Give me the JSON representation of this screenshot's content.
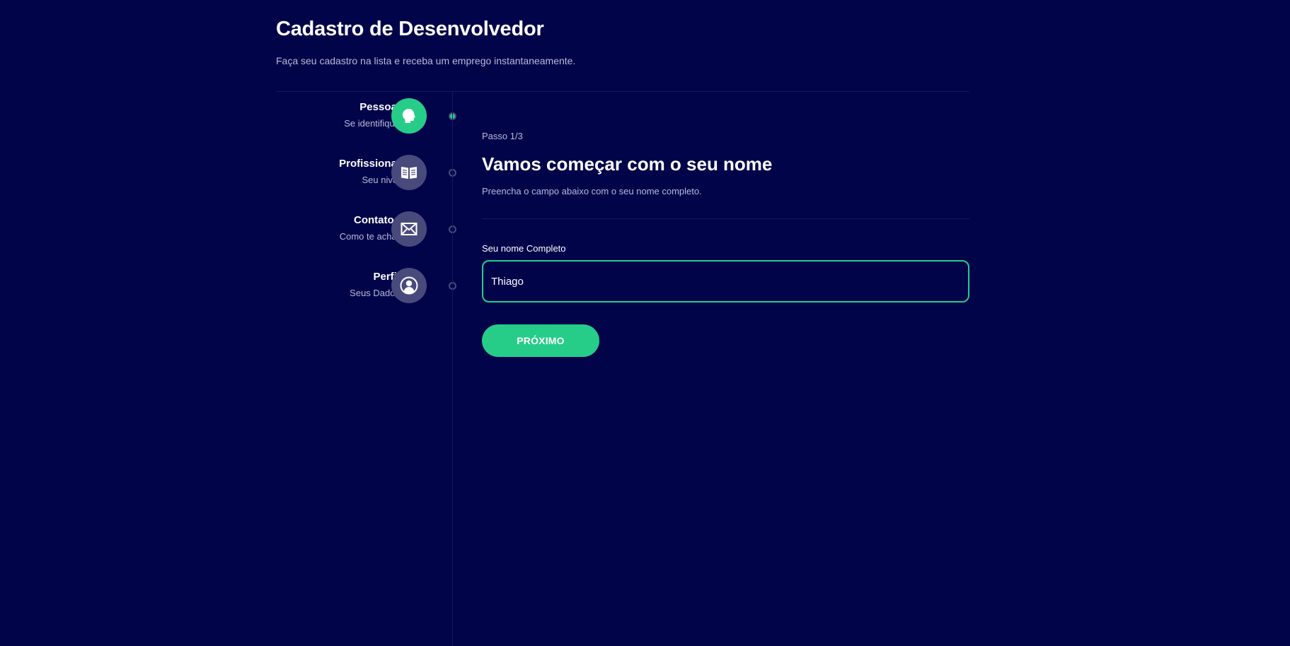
{
  "header": {
    "title": "Cadastro de Desenvolvedor",
    "subtitle": "Faça seu cadastro na lista e receba um emprego instantaneamente."
  },
  "steps": [
    {
      "title": "Pessoal",
      "subtitle": "Se identifique",
      "icon": "profile-head-icon",
      "active": true
    },
    {
      "title": "Profissional",
      "subtitle": "Seu nivel",
      "icon": "book-icon",
      "active": false
    },
    {
      "title": "Contatos",
      "subtitle": "Como te achar",
      "icon": "mail-icon",
      "active": false
    },
    {
      "title": "Perfil",
      "subtitle": "Seus Dados",
      "icon": "user-icon",
      "active": false
    }
  ],
  "main": {
    "step_count": "Passo 1/3",
    "heading": "Vamos começar com o seu nome",
    "description": "Preencha o campo abaixo com o seu nome completo.",
    "field_label": "Seu nome Completo",
    "name_value": "Thiago",
    "next_label": "PRÓXIMO"
  },
  "colors": {
    "background": "#02044a",
    "accent": "#25cd89",
    "inactive_icon": "#494a7c",
    "muted_text": "#b8b9d8",
    "divider": "#16195c"
  }
}
